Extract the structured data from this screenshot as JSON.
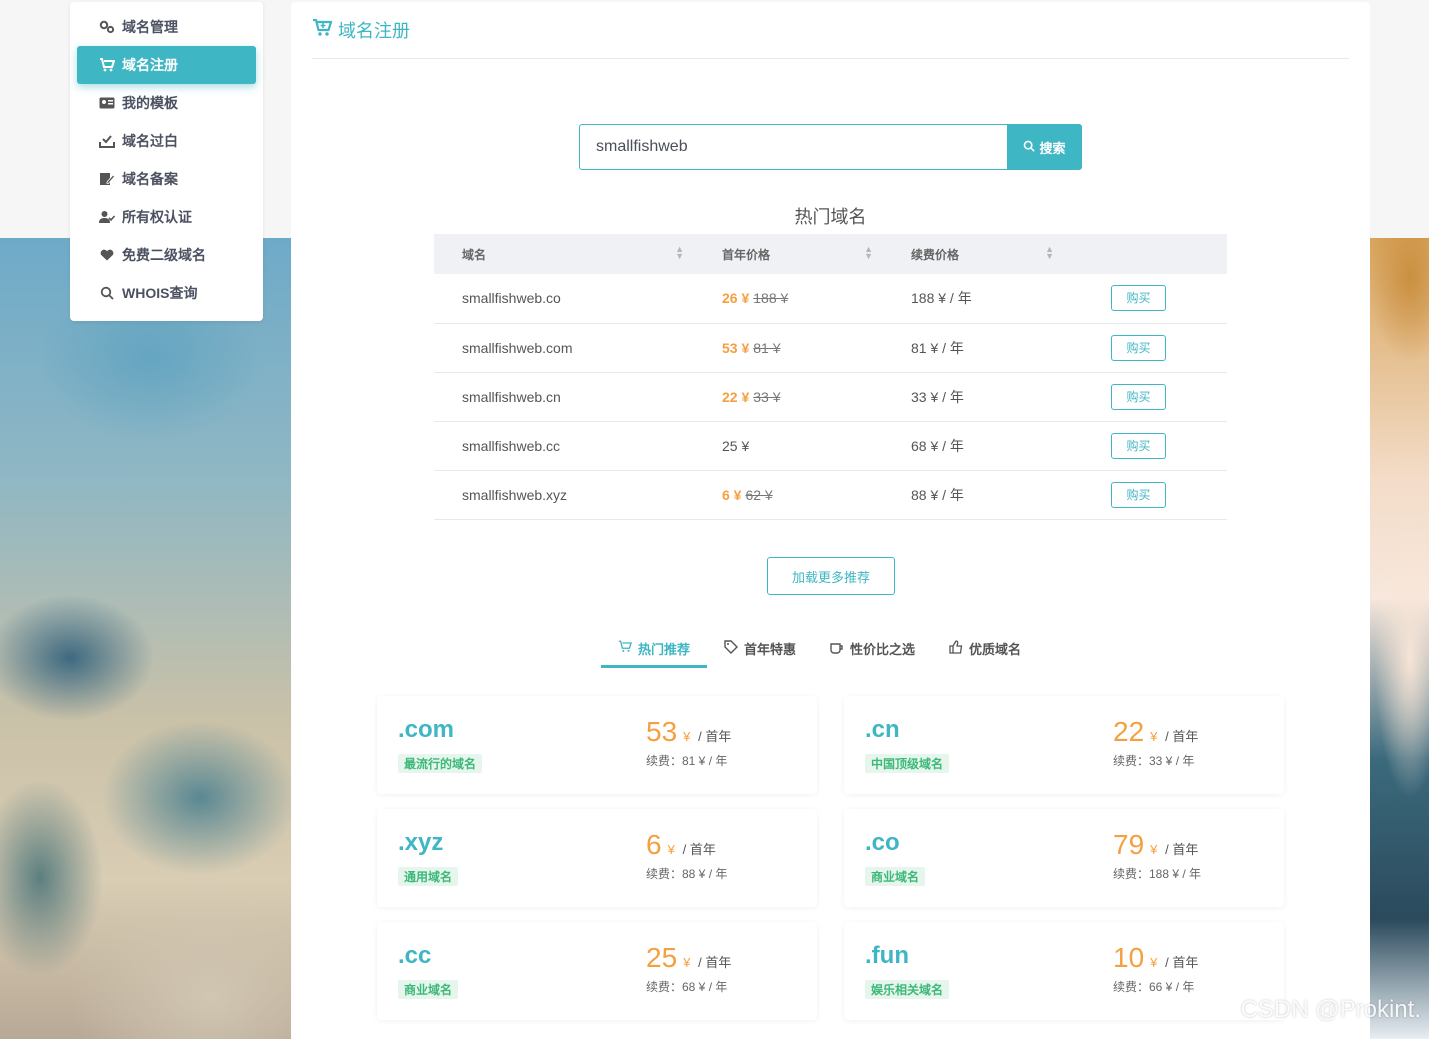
{
  "sidebar": {
    "items": [
      {
        "label": "域名管理",
        "icon": "gears-icon"
      },
      {
        "label": "域名注册",
        "icon": "cart-icon",
        "active": true
      },
      {
        "label": "我的模板",
        "icon": "id-card-icon"
      },
      {
        "label": "域名过白",
        "icon": "inbox-check-icon"
      },
      {
        "label": "域名备案",
        "icon": "edit-doc-icon"
      },
      {
        "label": "所有权认证",
        "icon": "user-check-icon"
      },
      {
        "label": "免费二级域名",
        "icon": "heart-icon"
      },
      {
        "label": "WHOIS查询",
        "icon": "search-icon"
      }
    ]
  },
  "header": {
    "title": "域名注册",
    "icon": "cart-plus-icon"
  },
  "search": {
    "value": "smallfishweb",
    "button_label": "搜索"
  },
  "hot": {
    "title": "热门域名",
    "columns": [
      "域名",
      "首年价格",
      "续费价格",
      ""
    ],
    "rows": [
      {
        "domain": "smallfishweb.co",
        "price": "26 ¥",
        "old": "188 ¥",
        "renew": "188 ¥ / 年",
        "action": "购买"
      },
      {
        "domain": "smallfishweb.com",
        "price": "53 ¥",
        "old": "81 ¥",
        "renew": "81 ¥ / 年",
        "action": "购买"
      },
      {
        "domain": "smallfishweb.cn",
        "price": "22 ¥",
        "old": "33 ¥",
        "renew": "33 ¥ / 年",
        "action": "购买"
      },
      {
        "domain": "smallfishweb.cc",
        "plain_price": "25 ¥",
        "renew": "68 ¥ / 年",
        "action": "购买"
      },
      {
        "domain": "smallfishweb.xyz",
        "price": "6 ¥",
        "old": "62 ¥",
        "renew": "88 ¥ / 年",
        "action": "购买"
      }
    ],
    "load_more": "加载更多推荐"
  },
  "tabs": [
    {
      "label": "热门推荐",
      "icon": "cart-icon",
      "active": true
    },
    {
      "label": "首年特惠",
      "icon": "tag-icon"
    },
    {
      "label": "性价比之选",
      "icon": "cup-icon"
    },
    {
      "label": "优质域名",
      "icon": "thumbs-up-icon"
    }
  ],
  "cards": [
    {
      "tld": ".com",
      "tag": "最流行的域名",
      "price": "53",
      "currency": "¥",
      "per": "/ 首年",
      "renew": "续费：81 ¥ / 年"
    },
    {
      "tld": ".cn",
      "tag": "中国顶级域名",
      "price": "22",
      "currency": "¥",
      "per": "/ 首年",
      "renew": "续费：33 ¥ / 年"
    },
    {
      "tld": ".xyz",
      "tag": "通用域名",
      "price": "6",
      "currency": "¥",
      "per": "/ 首年",
      "renew": "续费：88 ¥ / 年"
    },
    {
      "tld": ".co",
      "tag": "商业域名",
      "price": "79",
      "currency": "¥",
      "per": "/ 首年",
      "renew": "续费：188 ¥ / 年"
    },
    {
      "tld": ".cc",
      "tag": "商业域名",
      "price": "25",
      "currency": "¥",
      "per": "/ 首年",
      "renew": "续费：68 ¥ / 年"
    },
    {
      "tld": ".fun",
      "tag": "娱乐相关域名",
      "price": "10",
      "currency": "¥",
      "per": "/ 首年",
      "renew": "续费：66 ¥ / 年"
    }
  ],
  "watermark": "CSDN @Prokint.",
  "colors": {
    "accent": "#3fb6c4",
    "price": "#f5a040",
    "tag_green": "#3db87a"
  }
}
